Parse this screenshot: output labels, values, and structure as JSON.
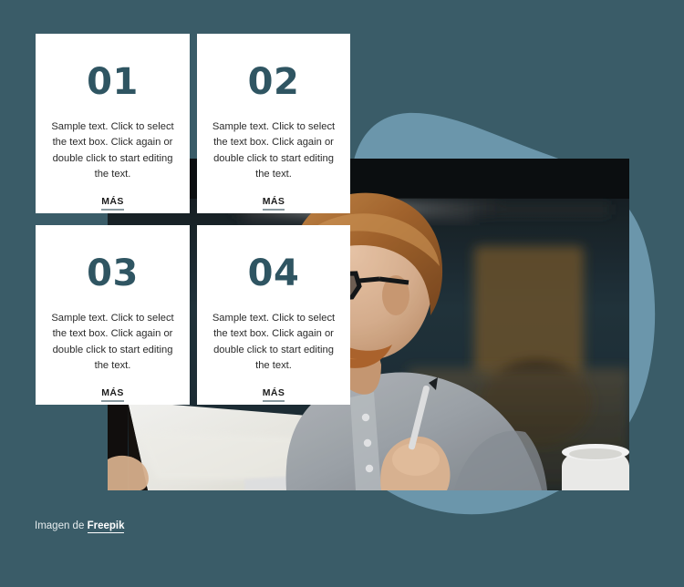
{
  "theme": {
    "background_color": "#3a5c68",
    "blob_color": "#6b96ab",
    "card_background": "#ffffff",
    "number_color": "#2f5562",
    "body_text_color": "#2b2b2b",
    "link_color": "#1b1b1b",
    "credit_text_color": "#e6ecee"
  },
  "cards": [
    {
      "number": "01",
      "text": "Sample text. Click to select the text box. Click again or double click to start editing the text.",
      "link_label": "MÁS"
    },
    {
      "number": "02",
      "text": "Sample text. Click to select the text box. Click again or double click to start editing the text.",
      "link_label": "MÁS"
    },
    {
      "number": "03",
      "text": "Sample text. Click to select the text box. Click again or double click to start editing the text.",
      "link_label": "MÁS"
    },
    {
      "number": "04",
      "text": "Sample text. Click to select the text box. Click again or double click to start editing the text.",
      "link_label": "MÁS"
    }
  ],
  "photo": {
    "alt": "Man with glasses, red hair and beard, wearing a gray henley shirt, writing with a pen next to a laptop and a white mug"
  },
  "credit": {
    "label": "Imagen de",
    "link_label": "Freepik"
  }
}
